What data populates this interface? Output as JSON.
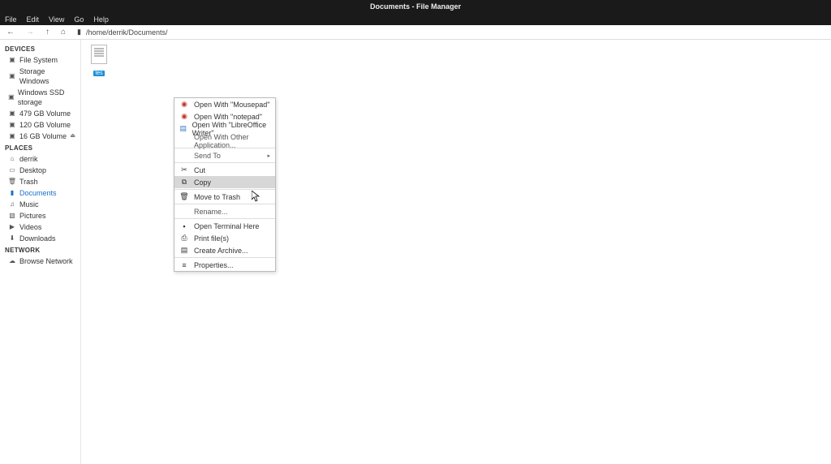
{
  "window": {
    "title": "Documents - File Manager"
  },
  "menubar": {
    "file": "File",
    "edit": "Edit",
    "view": "View",
    "go": "Go",
    "help": "Help"
  },
  "toolbar": {
    "path": "/home/derrik/Documents/"
  },
  "sidebar": {
    "devices_label": "DEVICES",
    "devices": [
      {
        "label": "File System"
      },
      {
        "label": "Storage Windows"
      },
      {
        "label": "Windows SSD storage"
      },
      {
        "label": "479 GB Volume"
      },
      {
        "label": "120 GB Volume"
      },
      {
        "label": "16 GB Volume"
      }
    ],
    "places_label": "PLACES",
    "places": [
      {
        "label": "derrik"
      },
      {
        "label": "Desktop"
      },
      {
        "label": "Trash"
      },
      {
        "label": "Documents"
      },
      {
        "label": "Music"
      },
      {
        "label": "Pictures"
      },
      {
        "label": "Videos"
      },
      {
        "label": "Downloads"
      }
    ],
    "network_label": "NETWORK",
    "network": [
      {
        "label": "Browse Network"
      }
    ]
  },
  "file": {
    "selected_name": "tes"
  },
  "contextmenu": {
    "open_mousepad": "Open With \"Mousepad\"",
    "open_notepad": "Open With \"notepad\"",
    "open_lowriter": "Open With \"LibreOffice Writer\"",
    "open_other": "Open With Other Application...",
    "send_to": "Send To",
    "cut": "Cut",
    "copy": "Copy",
    "move_trash": "Move to Trash",
    "rename": "Rename...",
    "open_terminal": "Open Terminal Here",
    "print": "Print file(s)",
    "create_archive": "Create Archive...",
    "properties": "Properties..."
  }
}
